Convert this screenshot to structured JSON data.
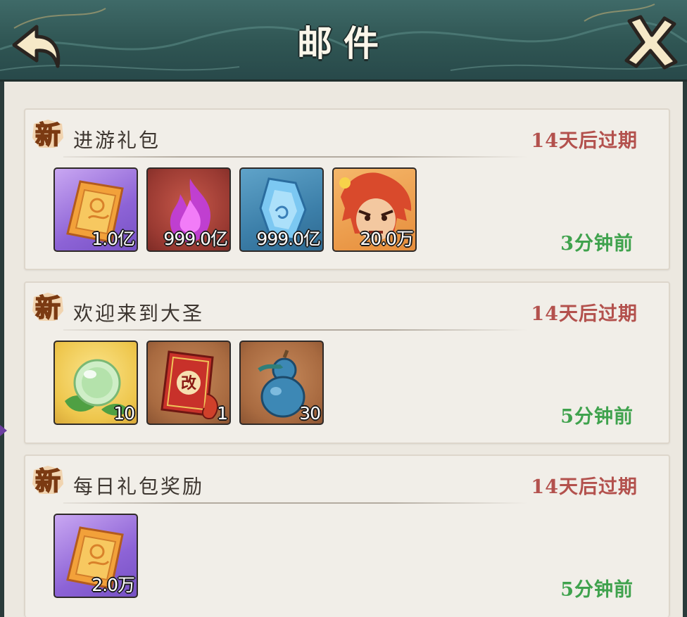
{
  "header": {
    "title": "邮件",
    "back_icon": "back-arrow-icon",
    "close_icon": "close-x-icon"
  },
  "mails": [
    {
      "badge": "新",
      "subject": "进游礼包",
      "expire": "14天后过期",
      "sent": "3分钟前",
      "items": [
        {
          "icon": "scroll-ticket-icon",
          "qty": "1.0亿"
        },
        {
          "icon": "purple-flame-icon",
          "qty": "999.0亿"
        },
        {
          "icon": "blue-crystal-icon",
          "qty": "999.0亿"
        },
        {
          "icon": "monkey-king-portrait-icon",
          "qty": "20.0万"
        }
      ]
    },
    {
      "badge": "新",
      "subject": "欢迎来到大圣",
      "expire": "14天后过期",
      "sent": "5分钟前",
      "items": [
        {
          "icon": "green-orb-icon",
          "qty": "10"
        },
        {
          "icon": "red-book-icon",
          "qty": "1",
          "glyph": "改"
        },
        {
          "icon": "blue-gourd-icon",
          "qty": "30"
        }
      ]
    },
    {
      "badge": "新",
      "subject": "每日礼包奖励",
      "expire": "14天后过期",
      "sent": "5分钟前",
      "items": [
        {
          "icon": "scroll-ticket-icon",
          "qty": "2.0万"
        }
      ]
    }
  ],
  "colors": {
    "expire": "#b3514d",
    "sent": "#3fa24d",
    "header_bg": "#2f5553",
    "panel_bg": "#ece8e0"
  }
}
